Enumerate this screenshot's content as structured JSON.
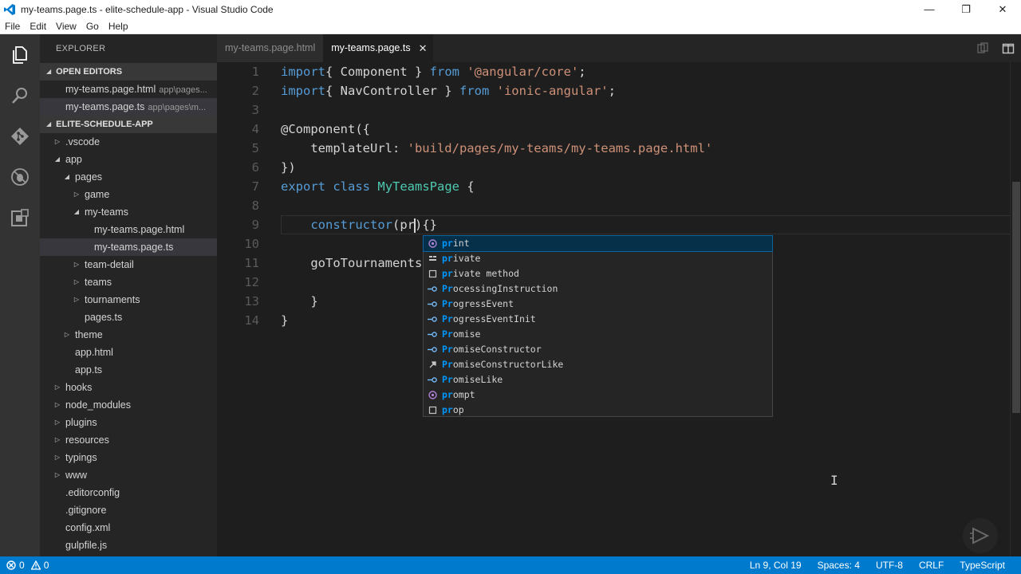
{
  "window": {
    "title": "my-teams.page.ts - elite-schedule-app - Visual Studio Code",
    "minimize": "—",
    "restore": "❐",
    "close": "✕"
  },
  "menu": [
    "File",
    "Edit",
    "View",
    "Go",
    "Help"
  ],
  "activity_bar": {
    "icons": [
      "files-icon",
      "search-icon",
      "git-icon",
      "debug-icon",
      "extensions-icon"
    ]
  },
  "sidebar": {
    "title": "EXPLORER",
    "open_editors_label": "OPEN EDITORS",
    "open_editors": [
      {
        "name": "my-teams.page.html",
        "path": "app\\pages..."
      },
      {
        "name": "my-teams.page.ts",
        "path": "app\\pages\\m..."
      }
    ],
    "project_label": "ELITE-SCHEDULE-APP",
    "tree": [
      {
        "label": ".vscode",
        "type": "folder",
        "expanded": false,
        "depth": 1
      },
      {
        "label": "app",
        "type": "folder",
        "expanded": true,
        "depth": 1
      },
      {
        "label": "pages",
        "type": "folder",
        "expanded": true,
        "depth": 2
      },
      {
        "label": "game",
        "type": "folder",
        "expanded": false,
        "depth": 3
      },
      {
        "label": "my-teams",
        "type": "folder",
        "expanded": true,
        "depth": 3
      },
      {
        "label": "my-teams.page.html",
        "type": "file",
        "depth": 4
      },
      {
        "label": "my-teams.page.ts",
        "type": "file",
        "depth": 4,
        "selected": true
      },
      {
        "label": "team-detail",
        "type": "folder",
        "expanded": false,
        "depth": 3
      },
      {
        "label": "teams",
        "type": "folder",
        "expanded": false,
        "depth": 3
      },
      {
        "label": "tournaments",
        "type": "folder",
        "expanded": false,
        "depth": 3
      },
      {
        "label": "pages.ts",
        "type": "file",
        "depth": 3
      },
      {
        "label": "theme",
        "type": "folder",
        "expanded": false,
        "depth": 2
      },
      {
        "label": "app.html",
        "type": "file",
        "depth": 2
      },
      {
        "label": "app.ts",
        "type": "file",
        "depth": 2
      },
      {
        "label": "hooks",
        "type": "folder",
        "expanded": false,
        "depth": 1
      },
      {
        "label": "node_modules",
        "type": "folder",
        "expanded": false,
        "depth": 1
      },
      {
        "label": "plugins",
        "type": "folder",
        "expanded": false,
        "depth": 1
      },
      {
        "label": "resources",
        "type": "folder",
        "expanded": false,
        "depth": 1
      },
      {
        "label": "typings",
        "type": "folder",
        "expanded": false,
        "depth": 1
      },
      {
        "label": "www",
        "type": "folder",
        "expanded": false,
        "depth": 1
      },
      {
        "label": ".editorconfig",
        "type": "file",
        "depth": 1
      },
      {
        "label": ".gitignore",
        "type": "file",
        "depth": 1
      },
      {
        "label": "config.xml",
        "type": "file",
        "depth": 1
      },
      {
        "label": "gulpfile.js",
        "type": "file",
        "depth": 1
      }
    ]
  },
  "tabs": [
    {
      "label": "my-teams.page.html",
      "active": false
    },
    {
      "label": "my-teams.page.ts",
      "active": true,
      "close": "✕"
    }
  ],
  "editor": {
    "lines": [
      [
        [
          "kw",
          "import"
        ],
        [
          "",
          "{ Component } "
        ],
        [
          "kw",
          "from"
        ],
        [
          "",
          ""
        ],
        [
          "str",
          " '@angular/core'"
        ],
        [
          "",
          ";"
        ]
      ],
      [
        [
          "kw",
          "import"
        ],
        [
          "",
          "{ NavController } "
        ],
        [
          "kw",
          "from"
        ],
        [
          "str",
          " 'ionic-angular'"
        ],
        [
          "",
          ";"
        ]
      ],
      [],
      [
        [
          "",
          "@Component({"
        ]
      ],
      [
        [
          "",
          "    templateUrl: "
        ],
        [
          "str",
          "'build/pages/my-teams/my-teams.page.html'"
        ]
      ],
      [
        [
          "",
          "})"
        ]
      ],
      [
        [
          "kw",
          "export"
        ],
        [
          "",
          " "
        ],
        [
          "kw",
          "class"
        ],
        [
          "",
          " "
        ],
        [
          "cls",
          "MyTeamsPage"
        ],
        [
          "",
          " {"
        ]
      ],
      [],
      [
        [
          "",
          "    "
        ],
        [
          "kw",
          "constructor"
        ],
        [
          "",
          "(pr"
        ],
        [
          "caret",
          ""
        ],
        [
          "",
          ")"
        ],
        [
          "",
          "{}"
        ]
      ],
      [],
      [
        [
          "",
          "    goToTournaments"
        ]
      ],
      [],
      [
        [
          "",
          "    }"
        ]
      ],
      [
        [
          "",
          "}"
        ]
      ]
    ],
    "line_numbers": [
      "1",
      "2",
      "3",
      "4",
      "5",
      "6",
      "7",
      "8",
      "9",
      "10",
      "11",
      "12",
      "13",
      "14"
    ]
  },
  "suggest": {
    "items": [
      {
        "label": "print",
        "kind": "function",
        "selected": true
      },
      {
        "label": "private",
        "kind": "keyword"
      },
      {
        "label": "private method",
        "kind": "snippet"
      },
      {
        "label": "ProcessingInstruction",
        "kind": "interface"
      },
      {
        "label": "ProgressEvent",
        "kind": "interface"
      },
      {
        "label": "ProgressEventInit",
        "kind": "interface"
      },
      {
        "label": "Promise",
        "kind": "interface"
      },
      {
        "label": "PromiseConstructor",
        "kind": "interface"
      },
      {
        "label": "PromiseConstructorLike",
        "kind": "type"
      },
      {
        "label": "PromiseLike",
        "kind": "interface"
      },
      {
        "label": "prompt",
        "kind": "function"
      },
      {
        "label": "prop",
        "kind": "snippet"
      }
    ]
  },
  "statusbar": {
    "errors": "0",
    "warnings": "0",
    "position": "Ln 9, Col 19",
    "spaces": "Spaces: 4",
    "encoding": "UTF-8",
    "eol": "CRLF",
    "language": "TypeScript"
  },
  "colors": {
    "accent": "#007acc",
    "keyword": "#569cd6",
    "string": "#ce9178",
    "class": "#4ec9b0",
    "match": "#0097fb"
  }
}
